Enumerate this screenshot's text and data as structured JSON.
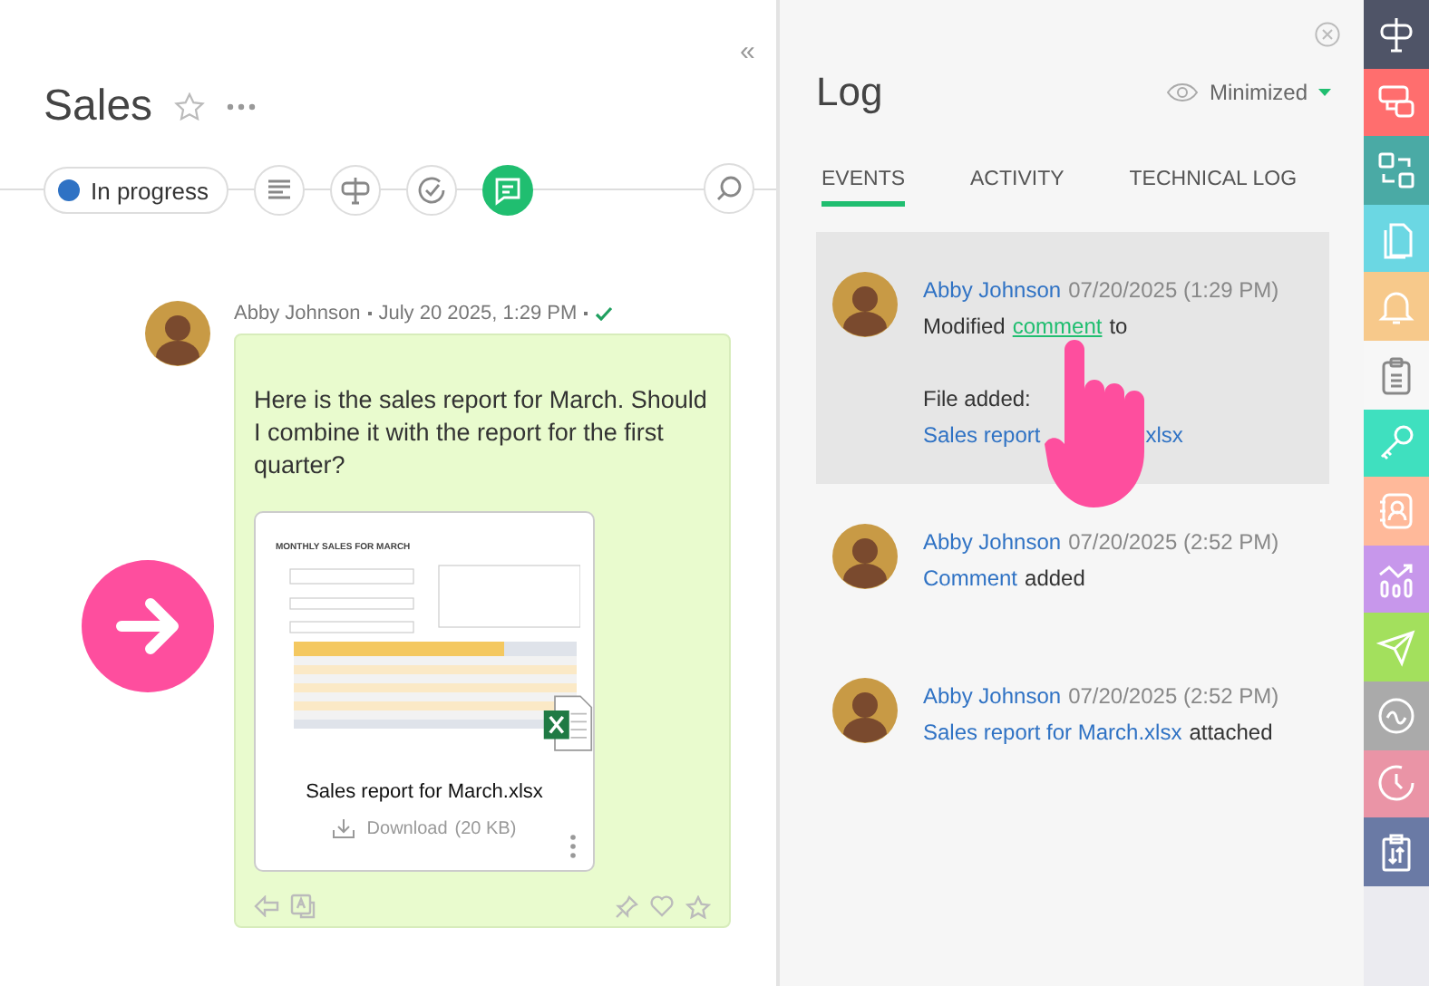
{
  "header": {
    "collapse": "«",
    "title": "Sales"
  },
  "toolbar": {
    "status": {
      "label": "In progress",
      "color": "#2f72c4"
    },
    "buttons": [
      {
        "kind": "fields",
        "selected": false
      },
      {
        "kind": "signpost",
        "selected": false
      },
      {
        "kind": "check",
        "selected": false
      },
      {
        "kind": "chat",
        "selected": true
      }
    ]
  },
  "message": {
    "author": "Abby Johnson",
    "time": "July 20 2025, 1:29 PM",
    "delivered": true,
    "text": "Here is the sales report for March. Should I combine it with the report for the first quarter?",
    "attachment": {
      "preview_title": "MONTHLY SALES FOR MARCH",
      "name": "Sales report for March.xlsx",
      "download": "Download",
      "size": "(20 KB)"
    }
  },
  "log": {
    "title": "Log",
    "view": "Minimized",
    "tabs": [
      {
        "label": "EVENTS",
        "selected": true
      },
      {
        "label": "ACTIVITY",
        "selected": false
      },
      {
        "label": "TECHNICAL LOG",
        "selected": false
      }
    ],
    "entries": [
      {
        "author": "Abby Johnson",
        "time": "07/20/2025 (1:29 PM)",
        "highlighted": true,
        "pointer": true,
        "lines": [
          [
            {
              "kind": "plain",
              "text": "Modified"
            },
            {
              "kind": "underlined_link",
              "text": "comment"
            },
            {
              "kind": "plain",
              "text": "to"
            }
          ]
        ],
        "details": [
          [
            {
              "kind": "plain",
              "text": "File added:"
            }
          ],
          [
            {
              "kind": "link",
              "text": "Sales report"
            },
            {
              "kind": "covered_link",
              "text": "xlsx"
            }
          ]
        ]
      },
      {
        "author": "Abby Johnson",
        "time": "07/20/2025 (2:52 PM)",
        "highlighted": false,
        "lines": [
          [
            {
              "kind": "link",
              "text": "Comment"
            },
            {
              "kind": "plain",
              "text": "added"
            }
          ]
        ]
      },
      {
        "author": "Abby Johnson",
        "time": "07/20/2025 (2:52 PM)",
        "highlighted": false,
        "lines": [
          [
            {
              "kind": "link",
              "text": "Sales report for March.xlsx"
            },
            {
              "kind": "plain",
              "text": "attached"
            }
          ]
        ]
      }
    ]
  },
  "sidebar": [
    {
      "kind": "signpost",
      "color": "#4f5467",
      "selected": false
    },
    {
      "kind": "screens",
      "color": "#ff6e6e",
      "selected": false
    },
    {
      "kind": "swap",
      "color": "#4aaaa5",
      "selected": false
    },
    {
      "kind": "documents",
      "color": "#6bd7e3",
      "selected": false
    },
    {
      "kind": "bell",
      "color": "#f7c98b",
      "selected": false
    },
    {
      "kind": "clipboard",
      "color": "#f7f7f7",
      "selected": true
    },
    {
      "kind": "key",
      "color": "#3fe0bf",
      "selected": false
    },
    {
      "kind": "contact",
      "color": "#ffb99a",
      "selected": false
    },
    {
      "kind": "chart",
      "color": "#c797eb",
      "selected": false
    },
    {
      "kind": "send",
      "color": "#a3e05d",
      "selected": false
    },
    {
      "kind": "wave",
      "color": "#aaaaaa",
      "selected": false
    },
    {
      "kind": "clock",
      "color": "#ea94a6",
      "selected": false
    },
    {
      "kind": "transfer",
      "color": "#6a7aa5",
      "selected": false
    }
  ]
}
